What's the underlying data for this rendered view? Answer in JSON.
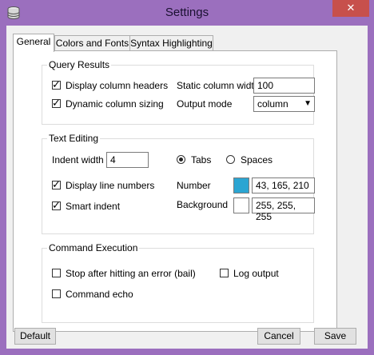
{
  "window": {
    "title": "Settings",
    "close_glyph": "✕"
  },
  "tabs": [
    {
      "label": "General"
    },
    {
      "label": "Colors and Fonts"
    },
    {
      "label": "Syntax Highlighting"
    }
  ],
  "query_results": {
    "title": "Query Results",
    "display_headers_label": "Display column headers",
    "display_headers_checked": true,
    "dynamic_sizing_label": "Dynamic column sizing",
    "dynamic_sizing_checked": true,
    "static_width_label": "Static column width",
    "static_width_value": "100",
    "output_mode_label": "Output mode",
    "output_mode_value": "column"
  },
  "text_editing": {
    "title": "Text Editing",
    "indent_width_label": "Indent width",
    "indent_width_value": "4",
    "tabs_label": "Tabs",
    "spaces_label": "Spaces",
    "tabs_selected": true,
    "line_numbers_label": "Display line numbers",
    "line_numbers_checked": true,
    "smart_indent_label": "Smart indent",
    "smart_indent_checked": true,
    "number_label": "Number",
    "number_value": "43, 165, 210",
    "number_color": "#2ba5d2",
    "background_label": "Background",
    "background_value": "255, 255, 255",
    "background_color": "#ffffff"
  },
  "command_execution": {
    "title": "Command Execution",
    "stop_label": "Stop after hitting an error (bail)",
    "stop_checked": false,
    "log_label": "Log output",
    "log_checked": false,
    "echo_label": "Command echo",
    "echo_checked": false
  },
  "buttons": {
    "default": "Default",
    "cancel": "Cancel",
    "save": "Save"
  },
  "check_glyph": "✓",
  "colors": {
    "titlebar": "#9b6fbe",
    "close": "#c7504c"
  }
}
